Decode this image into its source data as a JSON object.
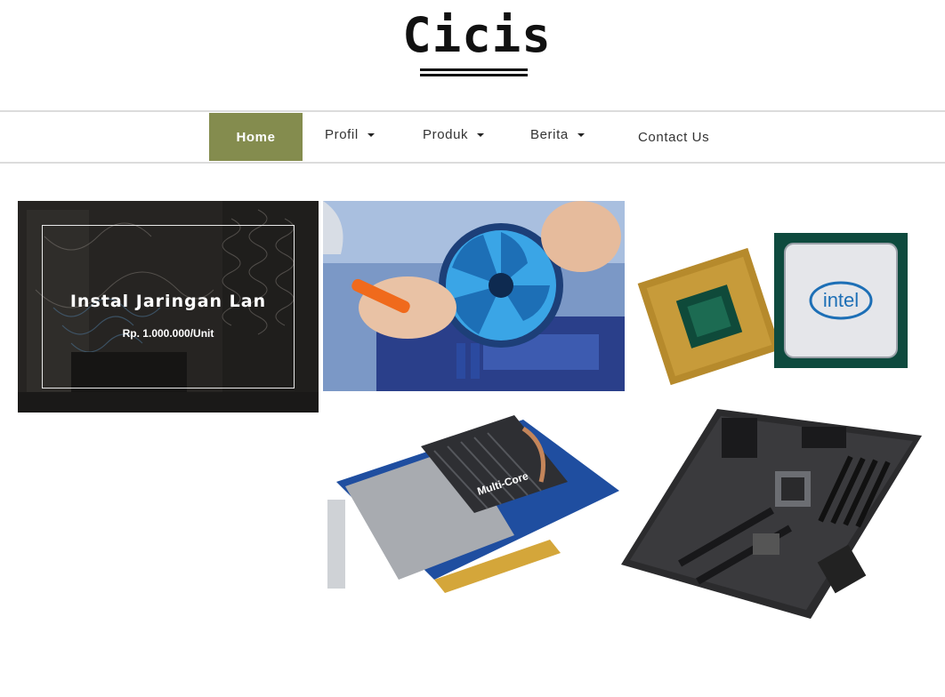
{
  "site": {
    "logo": "Cicis"
  },
  "nav": {
    "items": [
      {
        "label": "Home"
      },
      {
        "label": "Profil"
      },
      {
        "label": "Produk"
      },
      {
        "label": "Berita"
      },
      {
        "label": "Contact Us"
      }
    ]
  },
  "products": [
    {
      "title": "Instal Jaringan Lan",
      "price": "Rp. 1.000.000/Unit",
      "icon": "network-rack-image"
    },
    {
      "icon": "cpu-cooler-install-image"
    },
    {
      "icon": "intel-processor-image",
      "brand": "intel"
    },
    {
      "icon": "graphics-card-image",
      "brand": "Multi-Core"
    },
    {
      "icon": "motherboard-image"
    }
  ],
  "colors": {
    "accent": "#848c4e",
    "border": "#dcdcdc"
  }
}
